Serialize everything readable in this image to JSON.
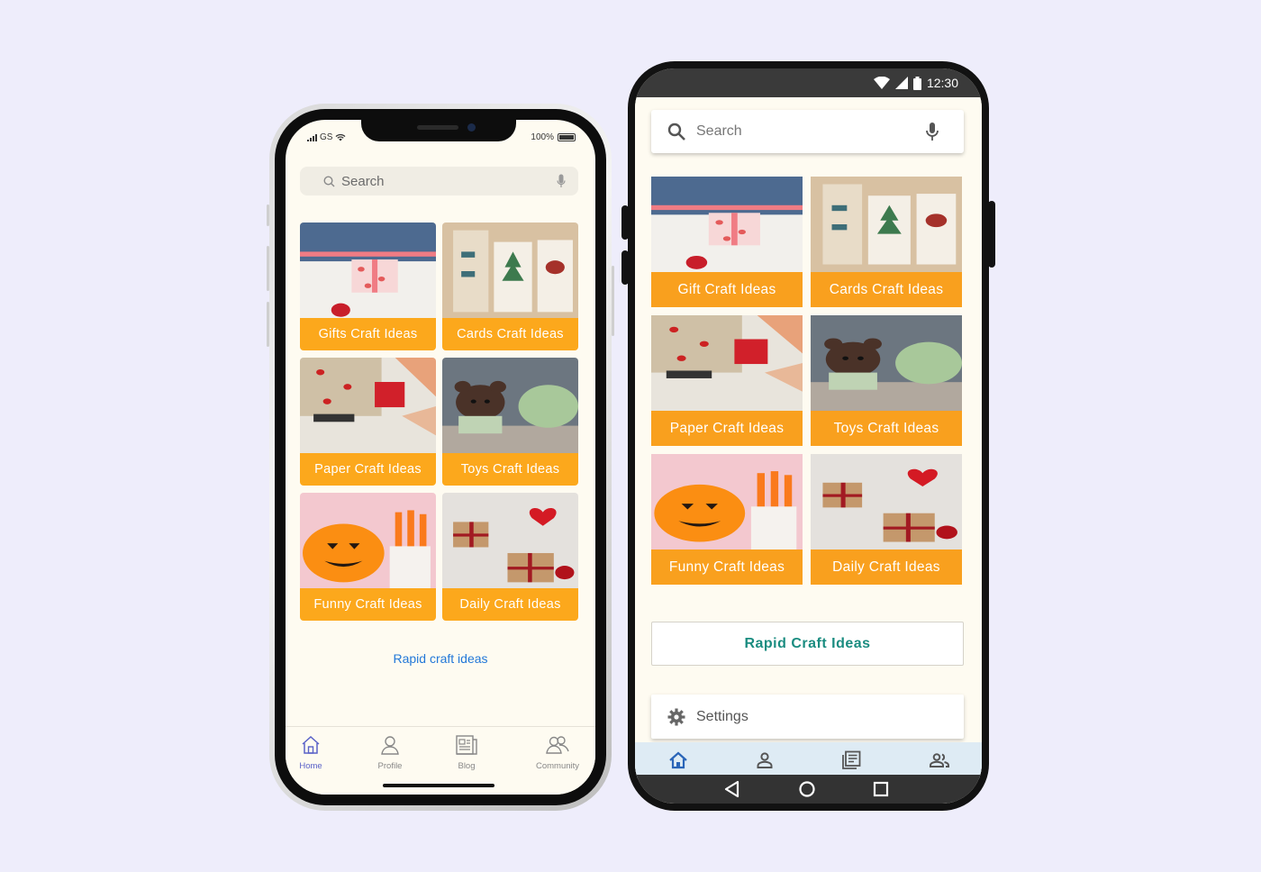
{
  "ios": {
    "carrier": "GS",
    "battery": "100%",
    "search": {
      "placeholder": "Search"
    },
    "tiles": [
      {
        "label": "Gifts Craft Ideas",
        "scene": "gift"
      },
      {
        "label": "Cards Craft Ideas",
        "scene": "cards"
      },
      {
        "label": "Paper Craft Ideas",
        "scene": "paper"
      },
      {
        "label": "Toys Craft Ideas",
        "scene": "toys"
      },
      {
        "label": "Funny Craft Ideas",
        "scene": "funny"
      },
      {
        "label": "Daily Craft Ideas",
        "scene": "daily"
      }
    ],
    "link": "Rapid craft ideas",
    "tabs": [
      {
        "label": "Home",
        "icon": "home-icon"
      },
      {
        "label": "Profile",
        "icon": "profile-icon"
      },
      {
        "label": "Blog",
        "icon": "blog-icon"
      },
      {
        "label": "Community",
        "icon": "community-icon"
      }
    ]
  },
  "android": {
    "time": "12:30",
    "search": {
      "placeholder": "Search"
    },
    "tiles": [
      {
        "label": "Gift Craft Ideas",
        "scene": "gift"
      },
      {
        "label": "Cards Craft Ideas",
        "scene": "cards"
      },
      {
        "label": "Paper Craft Ideas",
        "scene": "paper"
      },
      {
        "label": "Toys Craft Ideas",
        "scene": "toys"
      },
      {
        "label": "Funny Craft Ideas",
        "scene": "funny"
      },
      {
        "label": "Daily Craft Ideas",
        "scene": "daily"
      }
    ],
    "rapid_button": "Rapid Craft Ideas",
    "settings_label": "Settings",
    "nav_icons": [
      "home-icon",
      "person-icon",
      "news-icon",
      "people-icon"
    ]
  },
  "colors": {
    "background": "#eeedfb",
    "screen": "#fefbf1",
    "tile_caption": "#fca81c",
    "ios_link": "#2378d8",
    "ios_active_tab": "#5a62c8",
    "android_accent": "#1a8c80",
    "android_bottom_nav": "#deebf4"
  }
}
